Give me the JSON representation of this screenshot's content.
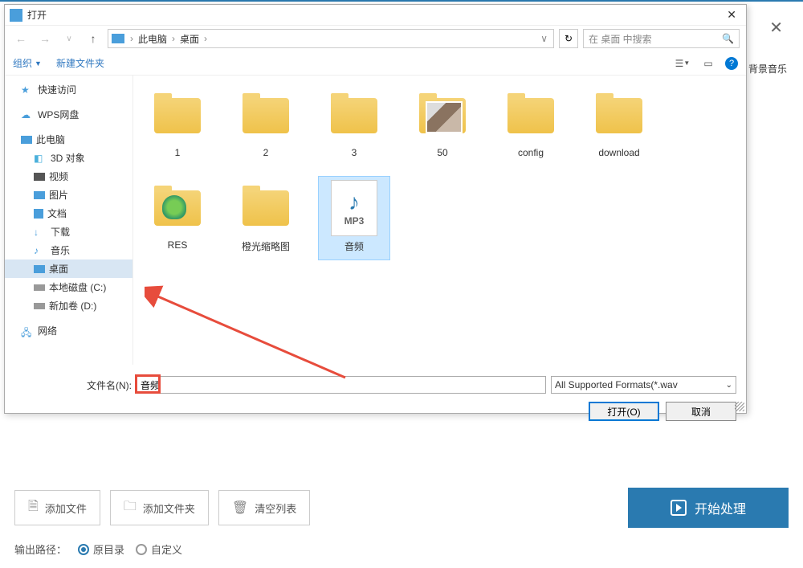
{
  "main": {
    "bg_music_label": "背景音乐"
  },
  "dialog": {
    "title": "打开",
    "breadcrumb": {
      "segment1": "此电脑",
      "segment2": "桌面"
    },
    "search_placeholder": "在 桌面 中搜索",
    "toolbar": {
      "organize": "组织",
      "new_folder": "新建文件夹"
    },
    "filename_label": "文件名(N):",
    "filename_value": "音频",
    "filetype_label": "All Supported Formats(*.wav",
    "open_btn": "打开(O)",
    "cancel_btn": "取消"
  },
  "sidebar": {
    "quick_access": "快速访问",
    "wps": "WPS网盘",
    "this_pc": "此电脑",
    "objects_3d": "3D 对象",
    "videos": "视频",
    "pictures": "图片",
    "documents": "文档",
    "downloads": "下载",
    "music": "音乐",
    "desktop": "桌面",
    "local_disk_c": "本地磁盘 (C:)",
    "volume_d": "新加卷 (D:)",
    "network": "网络"
  },
  "files": {
    "f1": "1",
    "f2": "2",
    "f3": "3",
    "f4": "50",
    "f5": "config",
    "f6": "download",
    "f7": "RES",
    "f8": "橙光缩略图",
    "f9": "音频",
    "mp3_tag": "MP3"
  },
  "bottom": {
    "add_file": "添加文件",
    "add_folder": "添加文件夹",
    "clear_list": "清空列表",
    "start": "开始处理",
    "output_label": "输出路径：",
    "original": "原目录",
    "custom": "自定义"
  }
}
